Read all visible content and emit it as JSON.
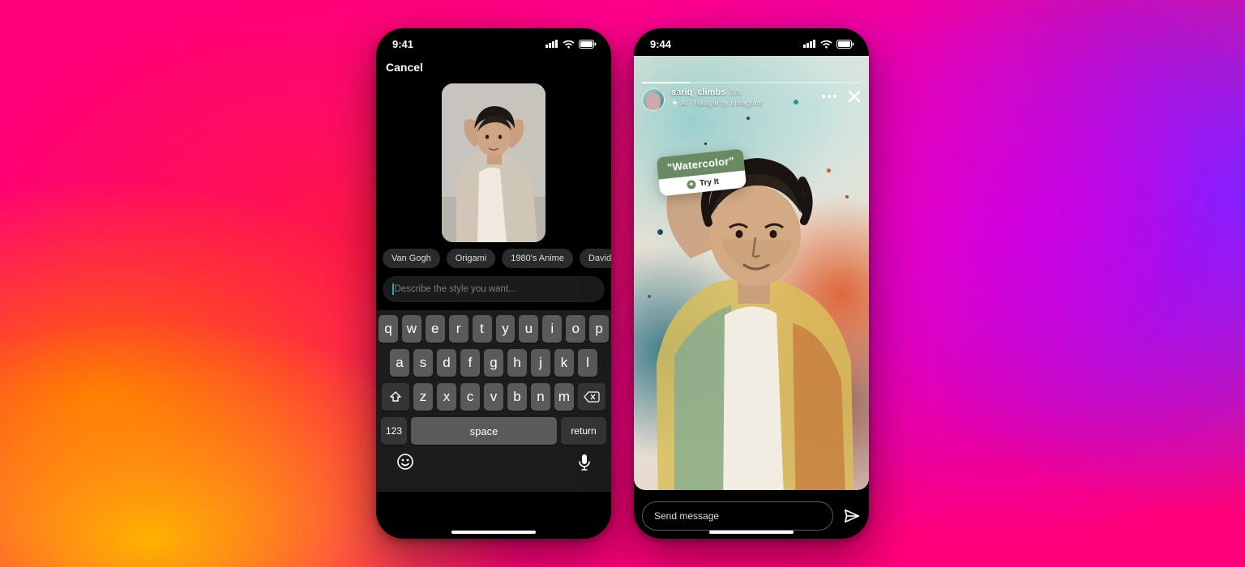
{
  "phoneA": {
    "status_time": "9:41",
    "cancel": "Cancel",
    "chips": [
      "Van Gogh",
      "Origami",
      "1980's Anime",
      "David Ho"
    ],
    "prompt_placeholder": "Describe the style you want...",
    "keyboard": {
      "row1": [
        "q",
        "w",
        "e",
        "r",
        "t",
        "y",
        "u",
        "i",
        "o",
        "p"
      ],
      "row2": [
        "a",
        "s",
        "d",
        "f",
        "g",
        "h",
        "j",
        "k",
        "l"
      ],
      "row3": [
        "z",
        "x",
        "c",
        "v",
        "b",
        "n",
        "m"
      ],
      "num_key": "123",
      "space_key": "space",
      "return_key": "return"
    }
  },
  "phoneB": {
    "status_time": "9:44",
    "username": "sariq_climbs",
    "age": "3m",
    "ai_label": "AI · Restyle by Instagram",
    "sticker_label": "\"Watercolor\"",
    "sticker_cta": "Try It",
    "message_placeholder": "Send message"
  }
}
